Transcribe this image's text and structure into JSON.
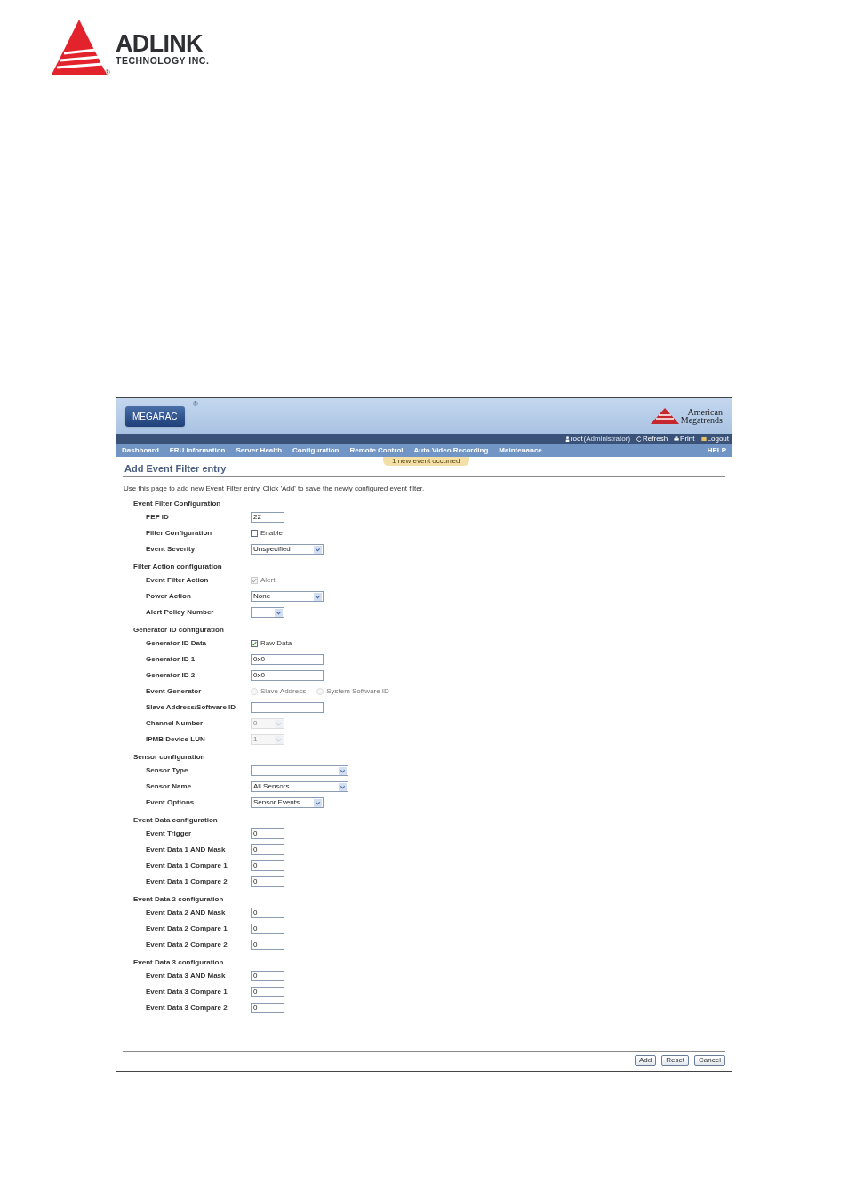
{
  "document_logo": {
    "name": "ADLINK",
    "subtitle": "TECHNOLOGY INC.",
    "mark": "®"
  },
  "app": {
    "logo": "MEGARAC",
    "logo_mark": "®",
    "vendor": [
      "American",
      "Megatrends"
    ],
    "user": {
      "name": "root",
      "role": "(Administrator)"
    },
    "toolbar": [
      "Refresh",
      "Print",
      "Logout"
    ],
    "nav": [
      "Dashboard",
      "FRU Information",
      "Server Health",
      "Configuration",
      "Remote Control",
      "Auto Video Recording",
      "Maintenance"
    ],
    "help": "HELP",
    "notification": "1 new event occurred",
    "page_title": "Add Event Filter entry",
    "description": "Use this page to add new Event Filter entry. Click 'Add' to save the newly configured event filter.",
    "sections": [
      {
        "title": "Event Filter Configuration",
        "fields": [
          {
            "label": "PEF ID",
            "kind": "input",
            "value": "22",
            "disabled": false
          },
          {
            "label": "Filter Configuration",
            "kind": "checkbox",
            "text": "Enable",
            "checked": false,
            "disabled": false
          },
          {
            "label": "Event Severity",
            "kind": "select",
            "value": "Unspecified",
            "disabled": false
          }
        ]
      },
      {
        "title": "Filter Action configuration",
        "fields": [
          {
            "label": "Event Filter Action",
            "kind": "checkbox",
            "text": "Alert",
            "checked": true,
            "disabled": true
          },
          {
            "label": "Power Action",
            "kind": "select",
            "value": "None",
            "disabled": false
          },
          {
            "label": "Alert Policy Number",
            "kind": "select-short",
            "disabled": false
          }
        ]
      },
      {
        "title": "Generator ID configuration",
        "fields": [
          {
            "label": "Generator ID Data",
            "kind": "checkbox",
            "text": "Raw Data",
            "checked": true,
            "disabled": false
          },
          {
            "label": "Generator ID 1",
            "kind": "input-wide",
            "value": "0x0",
            "disabled": false
          },
          {
            "label": "Generator ID 2",
            "kind": "input-wide",
            "value": "0x0",
            "disabled": false
          },
          {
            "label": "Event Generator",
            "kind": "radio",
            "options": [
              {
                "text": "Slave Address",
                "selected": false
              },
              {
                "text": "System Software ID",
                "selected": false
              }
            ],
            "disabled": true
          },
          {
            "label": "Slave Address/Software ID",
            "kind": "input-wide",
            "disabled": false
          },
          {
            "label": "Channel Number",
            "kind": "select-short",
            "value": "0",
            "disabled": true
          },
          {
            "label": "IPMB Device LUN",
            "kind": "select-short",
            "value": "1",
            "disabled": true
          }
        ]
      },
      {
        "title": "Sensor configuration",
        "fields": [
          {
            "label": "Sensor Type",
            "kind": "select-wide",
            "disabled": false
          },
          {
            "label": "Sensor Name",
            "kind": "select-wide",
            "value": "All Sensors",
            "disabled": false
          },
          {
            "label": "Event Options",
            "kind": "select",
            "value": "Sensor Events",
            "disabled": false
          }
        ]
      },
      {
        "title": "Event Data configuration",
        "fields": [
          {
            "label": "Event Trigger",
            "kind": "input",
            "value": "0",
            "disabled": false
          },
          {
            "label": "Event Data 1 AND Mask",
            "kind": "input",
            "value": "0",
            "disabled": false
          },
          {
            "label": "Event Data 1 Compare 1",
            "kind": "input",
            "value": "0",
            "disabled": false
          },
          {
            "label": "Event Data 1 Compare 2",
            "kind": "input",
            "value": "0",
            "disabled": false
          }
        ]
      },
      {
        "title": "Event Data 2 configuration",
        "fields": [
          {
            "label": "Event Data 2 AND Mask",
            "kind": "input",
            "value": "0",
            "disabled": false
          },
          {
            "label": "Event Data 2 Compare 1",
            "kind": "input",
            "value": "0",
            "disabled": false
          },
          {
            "label": "Event Data 2 Compare 2",
            "kind": "input",
            "value": "0",
            "disabled": false
          }
        ]
      },
      {
        "title": "Event Data 3 configuration",
        "fields": [
          {
            "label": "Event Data 3 AND Mask",
            "kind": "input",
            "value": "0",
            "disabled": false
          },
          {
            "label": "Event Data 3 Compare 1",
            "kind": "input",
            "value": "0",
            "disabled": false
          },
          {
            "label": "Event Data 3 Compare 2",
            "kind": "input",
            "value": "0",
            "disabled": false
          }
        ]
      }
    ],
    "buttons": [
      "Add",
      "Reset",
      "Cancel"
    ]
  }
}
